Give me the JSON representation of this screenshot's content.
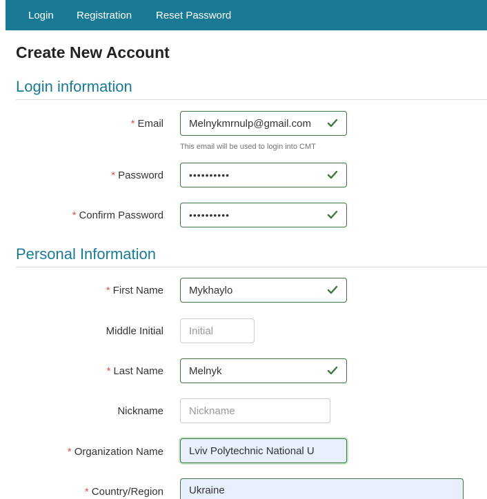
{
  "nav": {
    "items": [
      {
        "label": "Login"
      },
      {
        "label": "Registration"
      },
      {
        "label": "Reset Password"
      }
    ]
  },
  "page": {
    "title": "Create New Account"
  },
  "sections": {
    "login": "Login information",
    "personal": "Personal Information"
  },
  "required_marker": "*",
  "colors": {
    "nav_bg": "#1a7a96",
    "section_title": "#1a7a96",
    "required": "#d9534f",
    "valid": "#3c763d",
    "autofill_bg": "#e8f0fe"
  },
  "fields": {
    "email": {
      "label": "Email",
      "required": true,
      "value": "Melnykmrnulp@gmail.com",
      "help": "This email will be used to login into CMT",
      "valid": true,
      "icon": "checkmark-icon"
    },
    "password": {
      "label": "Password",
      "required": true,
      "value": "••••••••••",
      "valid": true,
      "icon": "checkmark-icon"
    },
    "confirm_password": {
      "label": "Confirm Password",
      "required": true,
      "value": "••••••••••",
      "valid": true,
      "icon": "checkmark-icon"
    },
    "first_name": {
      "label": "First Name",
      "required": true,
      "value": "Mykhaylo",
      "valid": true,
      "icon": "checkmark-icon"
    },
    "middle_initial": {
      "label": "Middle Initial",
      "required": false,
      "value": "",
      "placeholder": "Initial"
    },
    "last_name": {
      "label": "Last Name",
      "required": true,
      "value": "Melnyk",
      "valid": true,
      "icon": "checkmark-icon"
    },
    "nickname": {
      "label": "Nickname",
      "required": false,
      "value": "",
      "placeholder": "Nickname"
    },
    "organization": {
      "label": "Organization Name",
      "required": true,
      "value": "Lviv Polytechnic National U"
    },
    "country": {
      "label": "Country/Region",
      "required": true,
      "value": "Ukraine"
    }
  }
}
